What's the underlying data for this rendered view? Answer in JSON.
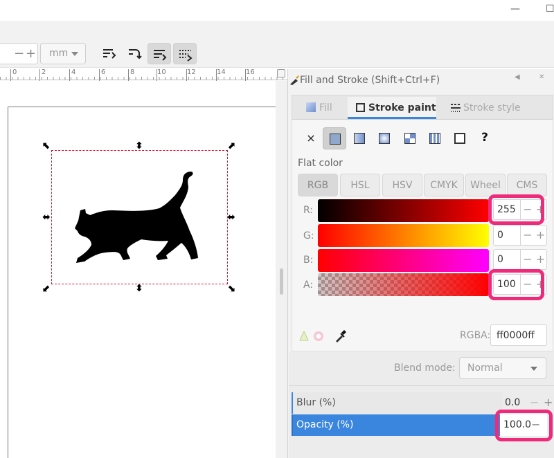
{
  "toolbar": {
    "unit": "mm",
    "stepper_minus": "−",
    "stepper_plus": "+"
  },
  "ruler": {
    "labels": [
      "0",
      "2",
      "4",
      "6",
      "8",
      "10",
      "12",
      "14",
      "16"
    ]
  },
  "panel": {
    "title": "Fill and Stroke (Shift+Ctrl+F)",
    "tabs": [
      {
        "label": "Fill",
        "active": false
      },
      {
        "label": "Stroke paint",
        "active": true
      },
      {
        "label": "Stroke style",
        "active": false
      }
    ],
    "paint_none_glyph": "×",
    "paint_unset_glyph": "?",
    "flat_color_label": "Flat color",
    "color_modes": [
      "RGB",
      "HSL",
      "HSV",
      "CMYK",
      "Wheel",
      "CMS"
    ],
    "channels": [
      {
        "label": "R:",
        "value": "255"
      },
      {
        "label": "G:",
        "value": "0"
      },
      {
        "label": "B:",
        "value": "0"
      },
      {
        "label": "A:",
        "value": "100"
      }
    ],
    "rgba_label": "RGBA:",
    "rgba_value": "ff0000ff",
    "blend_label": "Blend mode:",
    "blend_value": "Normal",
    "blur_label": "Blur (%)",
    "blur_value": "0.0",
    "opacity_label": "Opacity (%)",
    "opacity_value": "100.0"
  },
  "colors": {
    "accent": "#3a86df",
    "highlight": "#ee2a7b",
    "selection": "#e0102f",
    "stroke_color": "#ff0000"
  }
}
